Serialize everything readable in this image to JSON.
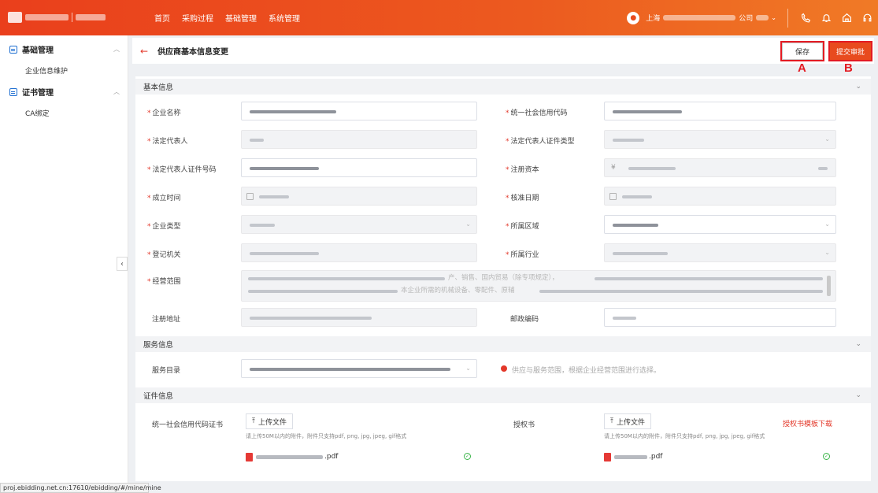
{
  "topbar": {
    "nav": [
      "首页",
      "采购过程",
      "基础管理",
      "系统管理"
    ],
    "company_prefix": "上海",
    "company_suffix": "公司",
    "user_chevron": "⌄"
  },
  "sidebar": {
    "groups": [
      {
        "label": "基础管理",
        "items": [
          "企业信息维护"
        ]
      },
      {
        "label": "证书管理",
        "items": [
          "CA绑定"
        ]
      }
    ]
  },
  "page": {
    "title": "供应商基本信息变更",
    "save_label": "保存",
    "submit_label": "提交审批",
    "anno_a": "A",
    "anno_b": "B"
  },
  "sections": {
    "basic": "基本信息",
    "service": "服务信息",
    "cert": "证件信息"
  },
  "fields": {
    "company_name": "企业名称",
    "credit_code": "统一社会信用代码",
    "legal_rep": "法定代表人",
    "legal_rep_id_type": "法定代表人证件类型",
    "legal_rep_id_no": "法定代表人证件号码",
    "reg_capital": "注册资本",
    "founded": "成立时间",
    "approved": "核准日期",
    "company_type": "企业类型",
    "region": "所属区域",
    "reg_authority": "登记机关",
    "industry": "所属行业",
    "scope": "经营范围",
    "reg_address": "注册地址",
    "postcode": "邮政编码",
    "service_catalog": "服务目录"
  },
  "scope_visible_text": "产、销售、国内贸易（除专项规定），<br>本企业所需的机械设备、零配件、原辅",
  "reg_capital_symbol": "¥",
  "service_hint": "供应与服务范围，根据企业经营范围进行选择。",
  "cert": {
    "credit_cert_label": "统一社会信用代码证书",
    "auth_label": "授权书",
    "upload_label": "上传文件",
    "upload_hint": "请上传50M以内的附件，附件只支持pdf, png, jpg, jpeg, gif格式",
    "file_ext": ".pdf",
    "template_link": "授权书模板下载"
  },
  "statusbar": {
    "url": "proj.ebidding.net.cn:17610/ebidding/#/mine/mine"
  }
}
